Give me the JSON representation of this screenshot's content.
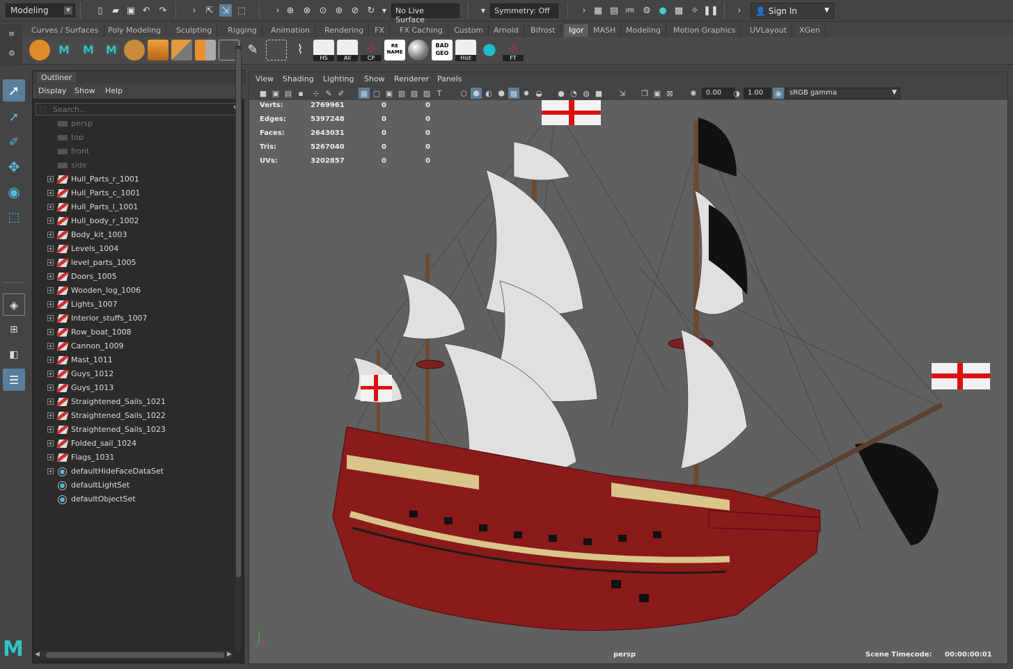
{
  "statusline": {
    "mode": "Modeling",
    "live_surface": "No Live Surface",
    "symmetry": "Symmetry: Off",
    "sign_in": "Sign In"
  },
  "shelf_tabs": [
    "Curves / Surfaces",
    "Poly Modeling",
    "Sculpting",
    "Rigging",
    "Animation",
    "Rendering",
    "FX",
    "FX Caching",
    "Custom",
    "Arnold",
    "Bifrost",
    "Igor",
    "MASH",
    "Modeling",
    "Motion Graphics",
    "UVLayout",
    "XGen"
  ],
  "shelf_active": "Igor",
  "shelf_buttons": {
    "hs": "HS",
    "all": "All",
    "cp": "CP",
    "rename": "RE NAME",
    "badgeo": "BAD GEO",
    "hist": "Hist",
    "ft": "FT"
  },
  "outliner": {
    "title": "Outliner",
    "menu": [
      "Display",
      "Show",
      "Help"
    ],
    "search_placeholder": "Search...",
    "cameras": [
      "persp",
      "top",
      "front",
      "side"
    ],
    "items": [
      "Hull_Parts_r_1001",
      "Hull_Parts_c_1001",
      "Hull_Parts_l_1001",
      "Hull_body_r_1002",
      "Body_kit_1003",
      "Levels_1004",
      "level_parts_1005",
      "Doors_1005",
      "Wooden_log_1006",
      "Lights_1007",
      "Interior_stuffs_1007",
      "Row_boat_1008",
      "Cannon_1009",
      "Mast_1011",
      "Guys_1012",
      "Guys_1013",
      "Straightened_Sails_1021",
      "Straightened_Sails_1022",
      "Straightened_Sails_1023",
      "Folded_sail_1024",
      "Flags_1031"
    ],
    "sets": [
      "defaultHideFaceDataSet",
      "defaultLightSet",
      "defaultObjectSet"
    ]
  },
  "viewport": {
    "menu": [
      "View",
      "Shading",
      "Lighting",
      "Show",
      "Renderer",
      "Panels"
    ],
    "exposure": "0.00",
    "gamma": "1.00",
    "color_space": "sRGB gamma",
    "hud": [
      {
        "label": "Verts:",
        "v1": "2769961",
        "v2": "0",
        "v3": "0"
      },
      {
        "label": "Edges:",
        "v1": "5397248",
        "v2": "0",
        "v3": "0"
      },
      {
        "label": "Faces:",
        "v1": "2643031",
        "v2": "0",
        "v3": "0"
      },
      {
        "label": "Tris:",
        "v1": "5267040",
        "v2": "0",
        "v3": "0"
      },
      {
        "label": "UVs:",
        "v1": "3202857",
        "v2": "0",
        "v3": "0"
      }
    ],
    "camera": "persp",
    "timecode_label": "Scene Timecode:",
    "timecode": "00:00:00:01"
  },
  "colors": {
    "accent": "#5a7f9c",
    "hull_red": "#8b1a1a",
    "sail": "#d8d8d8",
    "maya_teal": "#2ec4c4"
  }
}
